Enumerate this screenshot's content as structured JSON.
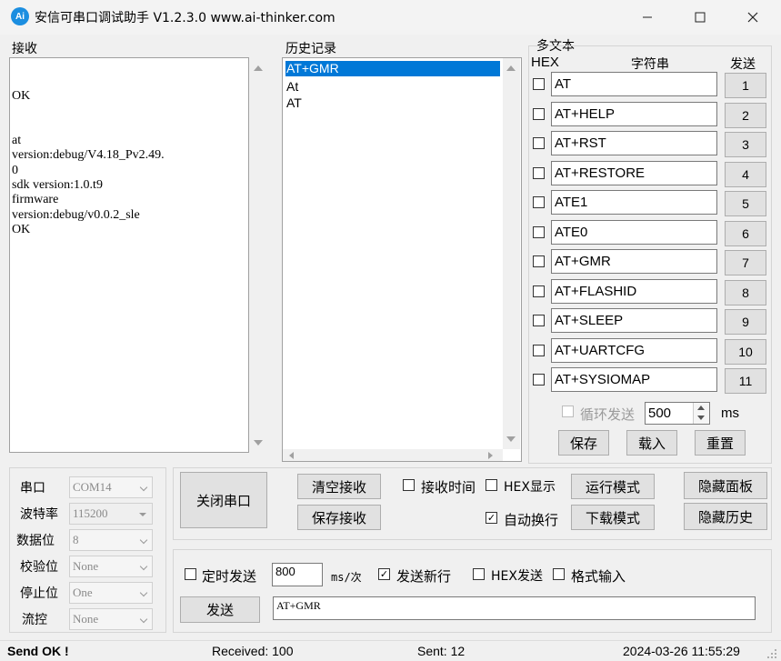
{
  "window": {
    "icon_text": "Ai",
    "title": "安信可串口调试助手 V1.2.3.0    www.ai-thinker.com"
  },
  "receive": {
    "label": "接收",
    "text": "\nOK\n\n\nat\nversion:debug/V4.18_Pv2.49.\n0\nsdk version:1.0.t9\nfirmware\nversion:debug/v0.0.2_sle\nOK"
  },
  "history": {
    "label": "历史记录",
    "items": [
      "AT+GMR",
      "At",
      "AT"
    ],
    "selected_index": 0
  },
  "multi": {
    "label": "多文本",
    "col_hex": "HEX",
    "col_string": "字符串",
    "col_send": "发送",
    "rows": [
      {
        "text": "AT",
        "num": "1"
      },
      {
        "text": "AT+HELP",
        "num": "2"
      },
      {
        "text": "AT+RST",
        "num": "3"
      },
      {
        "text": "AT+RESTORE",
        "num": "4"
      },
      {
        "text": "ATE1",
        "num": "5"
      },
      {
        "text": "ATE0",
        "num": "6"
      },
      {
        "text": "AT+GMR",
        "num": "7"
      },
      {
        "text": "AT+FLASHID",
        "num": "8"
      },
      {
        "text": "AT+SLEEP",
        "num": "9"
      },
      {
        "text": "AT+UARTCFG",
        "num": "10"
      },
      {
        "text": "AT+SYSIOMAP",
        "num": "11"
      }
    ],
    "loop_label": "循环发送",
    "loop_value": "500",
    "loop_unit": "ms",
    "save_label": "保存",
    "load_label": "载入",
    "reset_label": "重置"
  },
  "serial": {
    "port_label": "串口",
    "port_value": "COM14",
    "baud_label": "波特率",
    "baud_value": "115200",
    "databits_label": "数据位",
    "databits_value": "8",
    "parity_label": "校验位",
    "parity_value": "None",
    "stopbits_label": "停止位",
    "stopbits_value": "One",
    "flow_label": "流控",
    "flow_value": "None"
  },
  "controls": {
    "close_port": "关闭串口",
    "clear_recv": "清空接收",
    "save_recv": "保存接收",
    "recv_time": "接收时间",
    "hex_display": "HEX显示",
    "auto_newline": "自动换行",
    "run_mode": "运行模式",
    "download_mode": "下载模式",
    "hide_panel": "隐藏面板",
    "hide_history": "隐藏历史"
  },
  "send": {
    "timed_send": "定时发送",
    "interval_value": "800",
    "interval_unit": "ms/次",
    "send_newline": "发送新行",
    "hex_send": "HEX发送",
    "format_input": "格式输入",
    "send_button": "发送",
    "send_text": "AT+GMR"
  },
  "status": {
    "result": "Send OK !",
    "received": "Received: 100",
    "sent": "Sent: 12",
    "datetime": "2024-03-26 11:55:29"
  }
}
